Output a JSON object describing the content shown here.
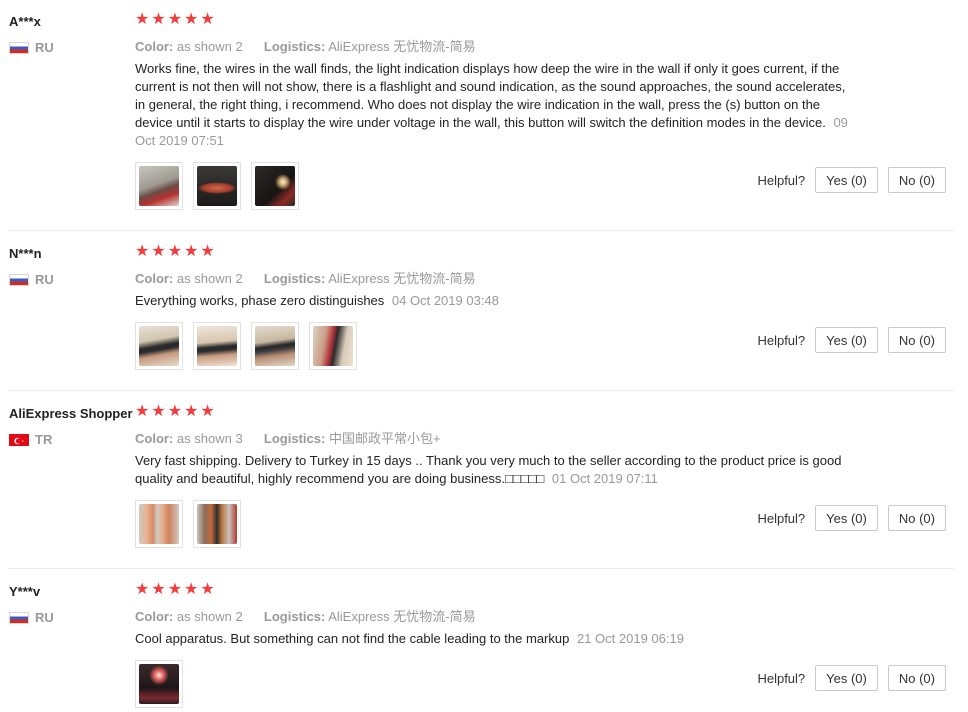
{
  "helpful_label": "Helpful?",
  "color_label": "Color:",
  "logistics_label": "Logistics:",
  "reviews": [
    {
      "user": "A***x",
      "country": "RU",
      "rating": 5,
      "color": "as shown 2",
      "logistics": "AliExpress 无忧物流-简易",
      "text": "Works fine, the wires in the wall finds, the light indication displays how deep the wire in the wall if only it goes current, if the current is not then will not show, there is a flashlight and sound indication, as the sound approaches, the sound accelerates, in general, the right thing, i recommend. Who does not display the wire indication in the wall, press the (s) button on the device until it starts to display the wire under voltage in the wall, this button will switch the definition modes in the device.",
      "date": "09 Oct 2019 07:51",
      "yes": "Yes (0)",
      "no": "No (0)"
    },
    {
      "user": "N***n",
      "country": "RU",
      "rating": 5,
      "color": "as shown 2",
      "logistics": "AliExpress 无忧物流-简易",
      "text": "Everything works, phase zero distinguishes",
      "date": "04 Oct 2019 03:48",
      "yes": "Yes (0)",
      "no": "No (0)"
    },
    {
      "user": "AliExpress Shopper",
      "country": "TR",
      "rating": 5,
      "color": "as shown 3",
      "logistics": "中国邮政平常小包+",
      "text": "Very fast shipping. Delivery to Turkey in 15 days .. Thank you very much to the seller according to the product price is good quality and beautiful, highly recommend you are doing business.□□□□□",
      "date": "01 Oct 2019 07:11",
      "yes": "Yes (0)",
      "no": "No (0)"
    },
    {
      "user": "Y***v",
      "country": "RU",
      "rating": 5,
      "color": "as shown 2",
      "logistics": "AliExpress 无忧物流-简易",
      "text": "Cool apparatus. But something can not find the cable leading to the markup",
      "date": "21 Oct 2019 06:19",
      "yes": "Yes (0)",
      "no": "No (0)"
    }
  ],
  "colors": {
    "star": "#f23d3d",
    "muted": "#999999",
    "text": "#222222"
  }
}
